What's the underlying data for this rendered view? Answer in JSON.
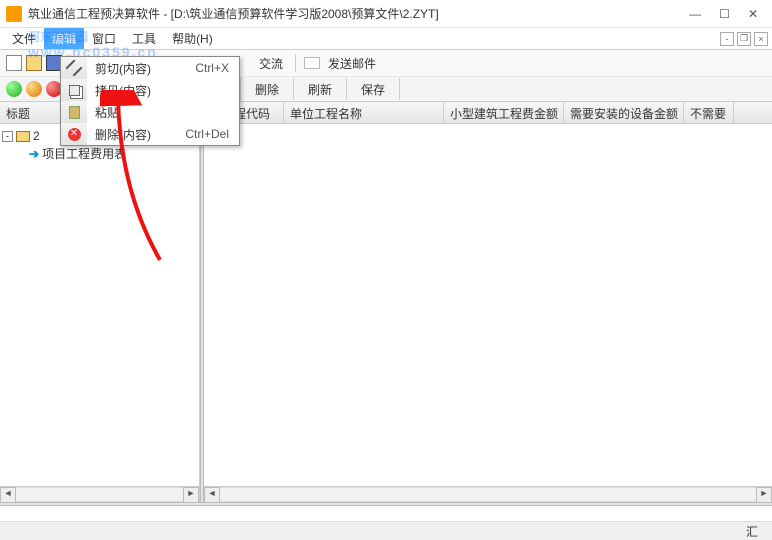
{
  "titlebar": {
    "text": "筑业通信工程预决算软件 - [D:\\筑业通信预算软件学习版2008\\预算文件\\2.ZYT]"
  },
  "watermark": {
    "text": "河东软件园",
    "url": "www.pc0359.cn"
  },
  "menubar": {
    "items": [
      "文件",
      "编辑",
      "窗口",
      "工具",
      "帮助(H)"
    ],
    "selected_index": 1
  },
  "toolbar1": {
    "exchange": "交流",
    "mail": "发送邮件"
  },
  "toolbar2": {
    "buttons": [
      "删除",
      "刷新",
      "保存"
    ]
  },
  "left": {
    "header": "标题",
    "root": {
      "label": "2",
      "expanded": true
    },
    "child": {
      "label": "项目工程费用表"
    }
  },
  "columns": [
    "位工程代码",
    "单位工程名称",
    "小型建筑工程费金额",
    "需要安装的设备金额",
    "不需要"
  ],
  "dropdown": {
    "items": [
      {
        "label": "剪切(内容)",
        "accel": "Ctrl+X",
        "icon": "cut"
      },
      {
        "label": "拷贝(内容)",
        "accel": "",
        "icon": "copy"
      },
      {
        "label": "粘贴",
        "accel": "",
        "icon": "paste"
      },
      {
        "label": "删除(内容)",
        "accel": "Ctrl+Del",
        "icon": "delete"
      }
    ]
  },
  "status": {
    "label": "汇"
  }
}
